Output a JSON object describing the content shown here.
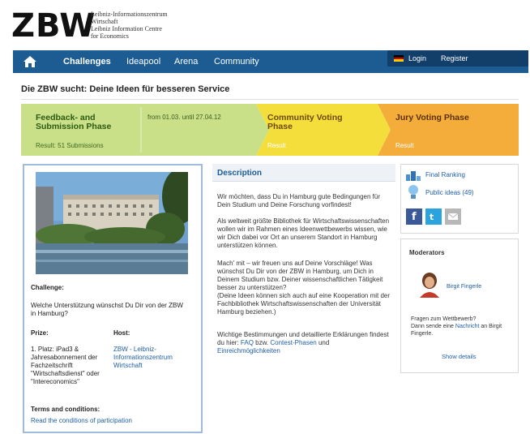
{
  "brand": {
    "logo": "ZBW",
    "lines": [
      "Leibniz-Informationszentrum",
      "Wirtschaft",
      "Leibniz Information Centre",
      "for Economics"
    ]
  },
  "nav": {
    "items": [
      "Challenges",
      "Ideapool",
      "Arena",
      "Community"
    ],
    "active": "Challenges",
    "login": "Login",
    "register": "Register"
  },
  "page_title": "Die ZBW sucht: Deine Ideen für besseren Service",
  "phases": [
    {
      "title": "Feedback- and Submission Phase",
      "sub": "Result: 51 Submissions"
    },
    {
      "dates": "from 01.03. until 27.04.12"
    },
    {
      "title": "Community Voting Phase",
      "sub": "Result"
    },
    {
      "title": "Jury Voting Phase",
      "sub": "Result"
    }
  ],
  "colors": {
    "nav": "#1d5c92",
    "phase_green": "#c9e089",
    "phase_yellow": "#f4de3c",
    "phase_orange": "#f4ad3b",
    "link": "#1f5ea8"
  },
  "left": {
    "challenge_label": "Challenge:",
    "challenge_text": "Welche Unterstützung wünschst Du Dir von der ZBW in Hamburg?",
    "prize_label": "Prize:",
    "prize_text": "1. Platz: iPad3 & Jahresabonnement der Fachzeitschrift \"Wirtschaftsdienst\" oder \"Intereconomics\"",
    "host_label": "Host:",
    "host_text": "ZBW - Leibniz-Informationszentrum Wirtschaft",
    "terms_label": "Terms and conditions:",
    "terms_link": "Read the conditions of participation"
  },
  "description": {
    "heading": "Description",
    "p1": "Wir möchten, dass Du in Hamburg gute Bedingungen für Dein Studium und Deine Forschung vorfindest!",
    "p2": "Als weltweit größte Bibliothek für Wirtschaftswissenschaften wollen wir im Rahmen eines Ideenwettbewerbs wissen, wie wir Dich dabei vor Ort an unserem Standort in Hamburg unterstützen können.",
    "p3": "Mach' mit – wir freuen uns auf Deine Vorschläge! Was wünschst Du Dir von der ZBW in Hamburg, um Dich in Deinem Studium bzw. Deiner wissenschaftlichen Tätigkeit besser zu unterstützen?",
    "p4": "(Deine Ideen können sich auch auf eine Kooperation mit der Fachbibliothek Wirtschaftswissenschaften der Universität Hamburg beziehen.)",
    "p5_a": "Wichtige Bestimmungen und detaillierte Erklärungen findest du hier: ",
    "p5_faq": "FAQ",
    "p5_b": " bzw. ",
    "p5_phases": "Contest-Phasen",
    "p5_c": " und ",
    "p5_options": "Einreichmöglichkeiten"
  },
  "right": {
    "final_ranking": "Final Ranking",
    "public_ideas": "Public ideas (49)",
    "moderators_title": "Moderators",
    "moderator_name": "Birgit Fingerle",
    "question": "Fragen zum Wettbewerb?",
    "contact_a": "Dann sende eine ",
    "contact_link": "Nachricht",
    "contact_b": " an Birgit Fingerle.",
    "show_details": "Show details"
  }
}
